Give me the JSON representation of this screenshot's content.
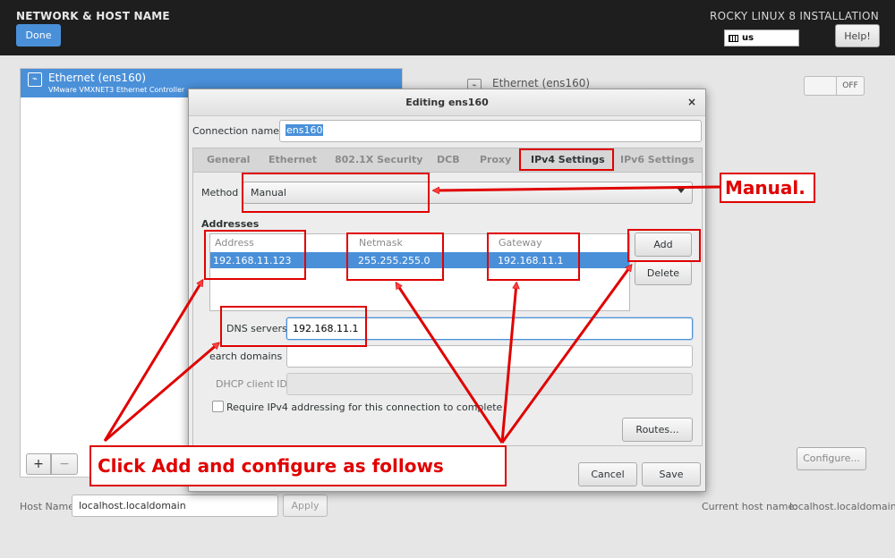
{
  "header": {
    "title": "NETWORK & HOST NAME",
    "done_label": "Done",
    "installer_title": "ROCKY LINUX 8 INSTALLATION",
    "keyboard_layout": "us",
    "help_label": "Help!"
  },
  "device_list": {
    "items": [
      {
        "name": "Ethernet (ens160)",
        "description": "VMware VMXNET3 Ethernet Controller",
        "selected": true
      }
    ],
    "add_label": "+",
    "remove_label": "−"
  },
  "device_detail": {
    "name": "Ethernet (ens160)",
    "toggle_label": "OFF",
    "configure_label": "Configure..."
  },
  "hostname": {
    "label": "Host Name:",
    "value": "localhost.localdomain",
    "apply_label": "Apply",
    "current_label": "Current host name:",
    "current_value": "localhost.localdomain"
  },
  "dialog": {
    "title": "Editing ens160",
    "close_glyph": "×",
    "connection_name_label": "Connection name",
    "connection_name_value": "ens160",
    "tabs": [
      "General",
      "Ethernet",
      "802.1X Security",
      "DCB",
      "Proxy",
      "IPv4 Settings",
      "IPv6 Settings"
    ],
    "active_tab": "IPv4 Settings",
    "method_label": "Method",
    "method_value": "Manual",
    "addresses_heading": "Addresses",
    "address_columns": [
      "Address",
      "Netmask",
      "Gateway"
    ],
    "address_rows": [
      {
        "address": "192.168.11.123",
        "netmask": "255.255.255.0",
        "gateway": "192.168.11.1"
      }
    ],
    "add_label": "Add",
    "delete_label": "Delete",
    "dns_label": "DNS servers",
    "dns_value": "192.168.11.1",
    "search_label": "Search domains",
    "search_label_visible": "earch domains",
    "dhcp_label": "DHCP client ID",
    "require_label": "Require IPv4 addressing for this connection to complete",
    "routes_label": "Routes...",
    "cancel_label": "Cancel",
    "save_label": "Save"
  },
  "annotations": {
    "manual_note": "Manual.",
    "click_note": "Click Add and configure as follows",
    "color": "#e00000"
  },
  "colors": {
    "accent": "#4a90d9",
    "topbar": "#1e1e1e"
  }
}
